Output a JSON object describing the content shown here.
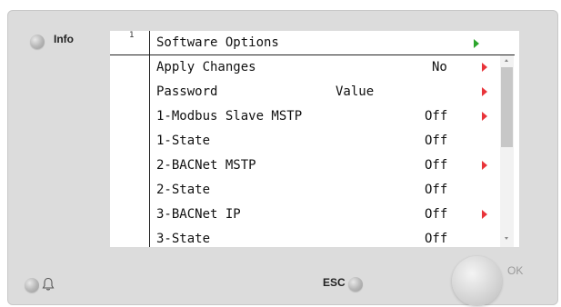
{
  "info_label": "Info",
  "esc_label": "ESC",
  "ok_label": "OK",
  "screen_number": "1",
  "header": {
    "title": "Software Options"
  },
  "rows": [
    {
      "name": "Apply Changes",
      "mid": "",
      "value": "No",
      "arrow": true
    },
    {
      "name": "Password",
      "mid": "Value",
      "value": "",
      "arrow": true
    },
    {
      "name": "1-Modbus Slave MSTP",
      "mid": "",
      "value": "Off",
      "arrow": true
    },
    {
      "name": "1-State",
      "mid": "",
      "value": "Off",
      "arrow": false
    },
    {
      "name": "2-BACNet MSTP",
      "mid": "",
      "value": "Off",
      "arrow": true
    },
    {
      "name": "2-State",
      "mid": "",
      "value": "Off",
      "arrow": false
    },
    {
      "name": "3-BACNet IP",
      "mid": "",
      "value": "Off",
      "arrow": true
    },
    {
      "name": "3-State",
      "mid": "",
      "value": "Off",
      "arrow": false
    }
  ],
  "colors": {
    "arrow_red": "#e8343a",
    "arrow_green": "#2ca52c",
    "panel": "#dcdcdc"
  }
}
